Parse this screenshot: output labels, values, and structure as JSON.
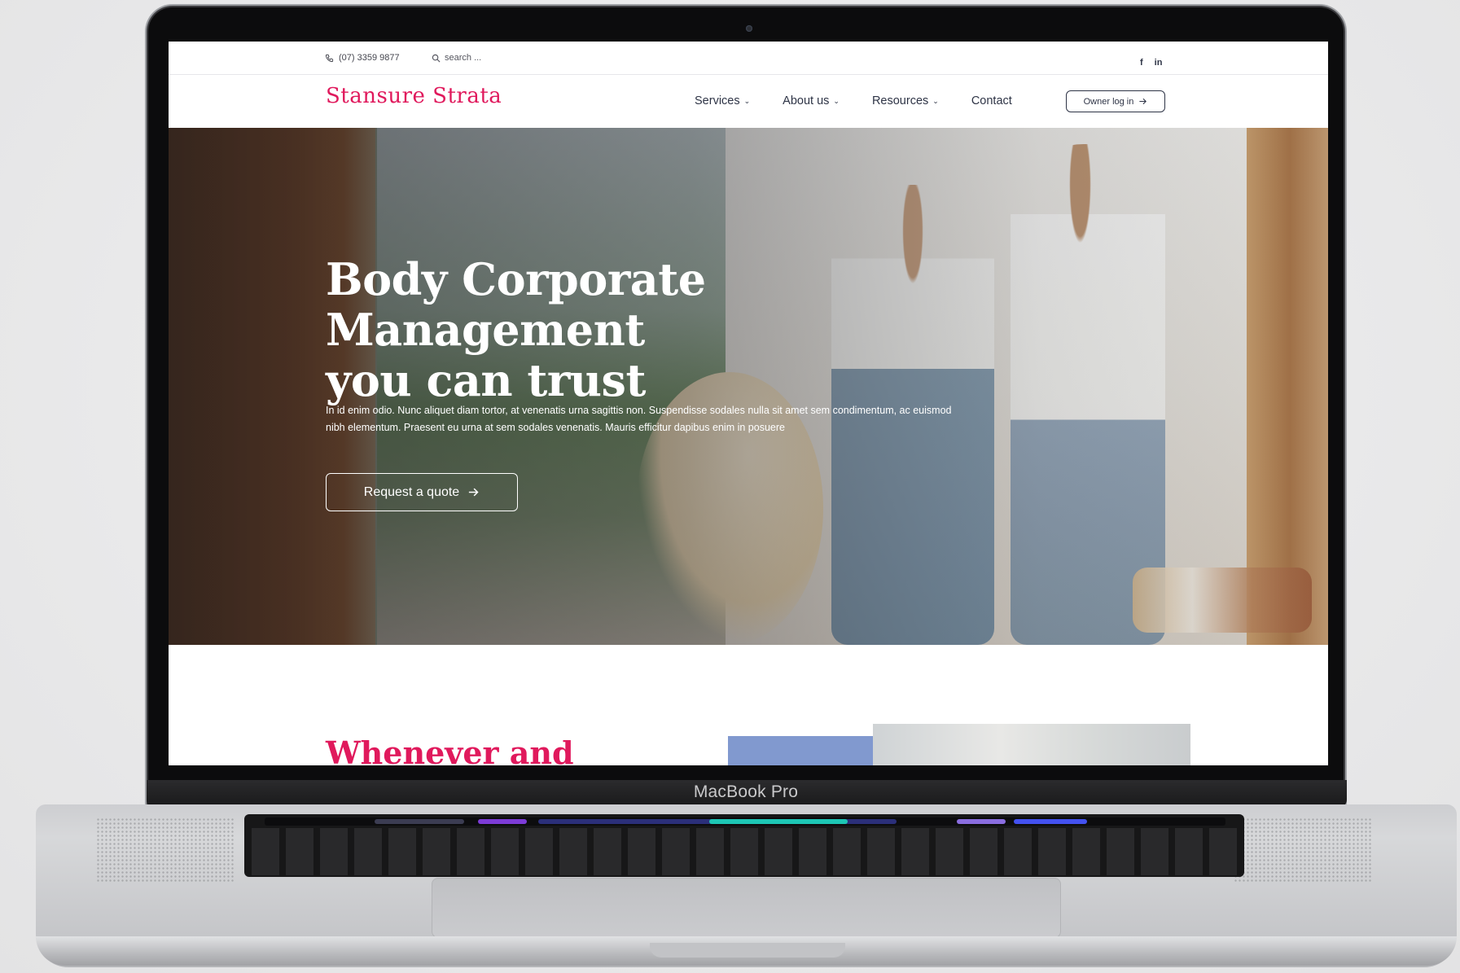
{
  "device": {
    "label": "MacBook Pro"
  },
  "topbar": {
    "phone": "(07) 3359 9877",
    "search_placeholder": "search ...",
    "social": {
      "facebook": "f",
      "linkedin": "in"
    }
  },
  "nav": {
    "logo": "Stansure Strata",
    "items": [
      {
        "label": "Services",
        "has_dropdown": true
      },
      {
        "label": "About us",
        "has_dropdown": true
      },
      {
        "label": "Resources",
        "has_dropdown": true
      },
      {
        "label": "Contact",
        "has_dropdown": false
      }
    ],
    "owner_login": "Owner log in"
  },
  "hero": {
    "title_line1": "Body Corporate Management",
    "title_line2": "you can trust",
    "text": "In id enim odio. Nunc aliquet diam tortor, at venenatis urna sagittis non. Suspendisse sodales nulla sit amet sem condimentum, ac euismod nibh elementum. Praesent eu urna at sem sodales venenatis. Mauris efficitur dapibus enim in posuere",
    "cta": "Request a quote"
  },
  "section": {
    "heading_partial": "Whenever and"
  },
  "colors": {
    "brand": "#e0195c",
    "text_dark": "#2e3446",
    "accent_block": "#8199cf"
  }
}
